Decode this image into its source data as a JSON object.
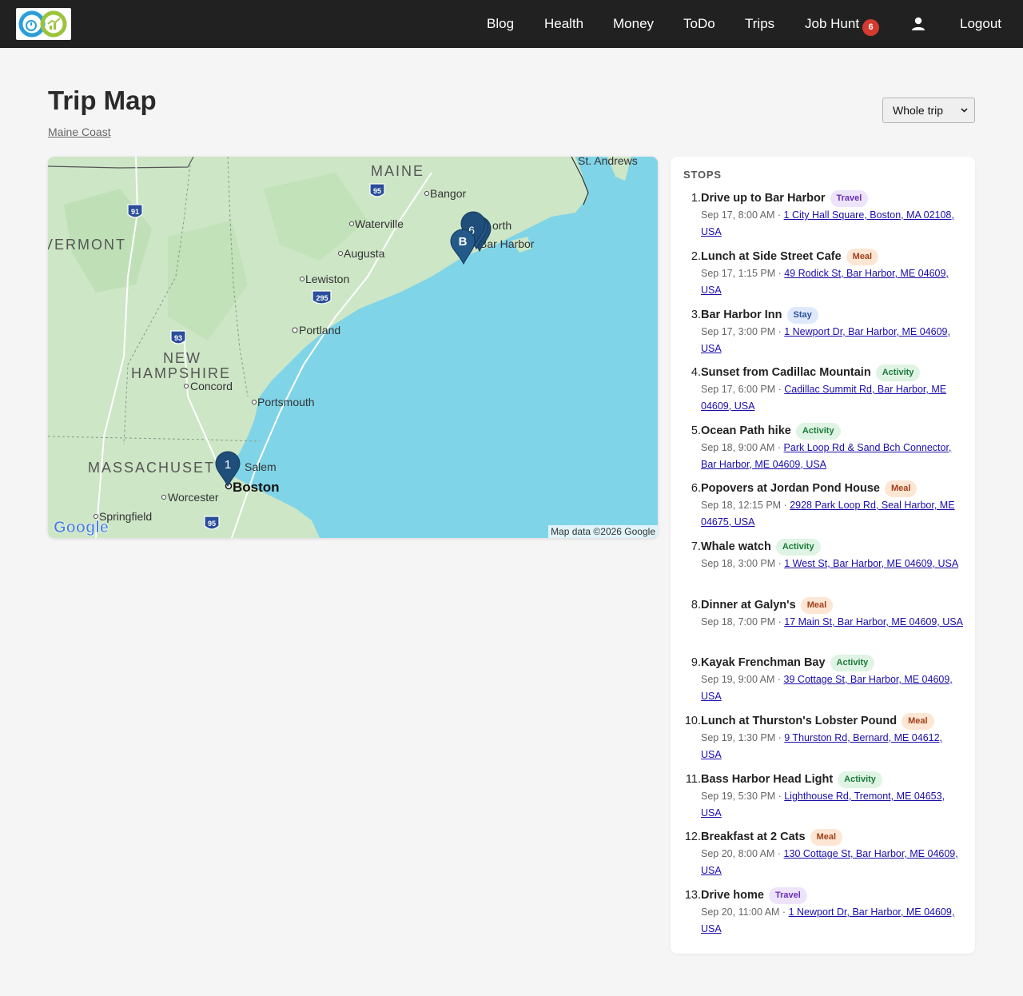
{
  "nav": {
    "items": [
      "Blog",
      "Health",
      "Money",
      "ToDo",
      "Trips"
    ],
    "job_hunt": "Job Hunt",
    "job_hunt_count": "6",
    "logout": "Logout"
  },
  "page": {
    "title": "Trip Map",
    "trip_link": "Maine Coast",
    "range_selected": "Whole trip"
  },
  "map": {
    "attribution": "Map data ©2026 Google",
    "logo_text": "Google",
    "labels": {
      "maine": "MAINE",
      "vermont": "VERMONT",
      "new_hampshire_1": "NEW",
      "new_hampshire_2": "HAMPSHIRE",
      "massachusetts": "MASSACHUSETTS",
      "st_andrews": "St. Andrews",
      "bangor": "Bangor",
      "waterville": "Waterville",
      "augusta": "Augusta",
      "lewiston": "Lewiston",
      "portland": "Portland",
      "concord": "Concord",
      "portsmouth": "Portsmouth",
      "salem": "Salem",
      "boston": "Boston",
      "worcester": "Worcester",
      "springfield": "Springfield",
      "ellsworth_fragment": "orth",
      "bar_harbor": "Bar Harbor"
    },
    "shields": {
      "i91": "91",
      "i95_north": "95",
      "i295": "295",
      "i93": "93",
      "i95_south": "95"
    },
    "markers": {
      "boston": "1",
      "cluster_back": "6",
      "cluster_front": "B"
    }
  },
  "stops": {
    "heading": "STOPS",
    "items": [
      {
        "num": "1.",
        "name": "Drive up to Bar Harbor",
        "tag": "Travel",
        "time": "Sep 17, 8:00 AM",
        "sep": " · ",
        "address": "1 City Hall Square, Boston, MA 02108, USA"
      },
      {
        "num": "2.",
        "name": "Lunch at Side Street Cafe",
        "tag": "Meal",
        "time": "Sep 17, 1:15 PM",
        "sep": " · ",
        "address": "49 Rodick St, Bar Harbor, ME 04609, USA"
      },
      {
        "num": "3.",
        "name": "Bar Harbor Inn",
        "tag": "Stay",
        "time": "Sep 17, 3:00 PM",
        "sep": " · ",
        "address": "1 Newport Dr, Bar Harbor, ME 04609, USA"
      },
      {
        "num": "4.",
        "name": "Sunset from Cadillac Mountain",
        "tag": "Activity",
        "time": "Sep 17, 6:00 PM",
        "sep": " · ",
        "address": "Cadillac Summit Rd, Bar Harbor, ME 04609, USA"
      },
      {
        "num": "5.",
        "name": "Ocean Path hike",
        "tag": "Activity",
        "time": "Sep 18, 9:00 AM",
        "sep": " · ",
        "address": "Park Loop Rd & Sand Bch Connector, Bar Harbor, ME 04609, USA"
      },
      {
        "num": "6.",
        "name": "Popovers at Jordan Pond House",
        "tag": "Meal",
        "time": "Sep 18, 12:15 PM",
        "sep": " · ",
        "address": "2928 Park Loop Rd, Seal Harbor, ME 04675, USA"
      },
      {
        "num": "7.",
        "name": "Whale watch",
        "tag": "Activity",
        "time": "Sep 18, 3:00 PM",
        "sep": " · ",
        "address": "1 West St, Bar Harbor, ME 04609, USA"
      },
      {
        "num": "8.",
        "name": "Dinner at Galyn's",
        "tag": "Meal",
        "time": "Sep 18, 7:00 PM",
        "sep": " · ",
        "address": "17 Main St, Bar Harbor, ME 04609, USA"
      },
      {
        "num": "9.",
        "name": "Kayak Frenchman Bay",
        "tag": "Activity",
        "time": "Sep 19, 9:00 AM",
        "sep": " · ",
        "address": "39 Cottage St, Bar Harbor, ME 04609, USA"
      },
      {
        "num": "10.",
        "name": "Lunch at Thurston's Lobster Pound",
        "tag": "Meal",
        "time": "Sep 19, 1:30 PM",
        "sep": " · ",
        "address": "9 Thurston Rd, Bernard, ME 04612, USA"
      },
      {
        "num": "11.",
        "name": "Bass Harbor Head Light",
        "tag": "Activity",
        "time": "Sep 19, 5:30 PM",
        "sep": " · ",
        "address": "Lighthouse Rd, Tremont, ME 04653, USA"
      },
      {
        "num": "12.",
        "name": "Breakfast at 2 Cats",
        "tag": "Meal",
        "time": "Sep 20, 8:00 AM",
        "sep": " · ",
        "address": "130 Cottage St, Bar Harbor, ME 04609, USA"
      },
      {
        "num": "13.",
        "name": "Drive home",
        "tag": "Travel",
        "time": "Sep 20, 11:00 AM",
        "sep": " · ",
        "address": "1 Newport Dr, Bar Harbor, ME 04609, USA"
      }
    ]
  }
}
